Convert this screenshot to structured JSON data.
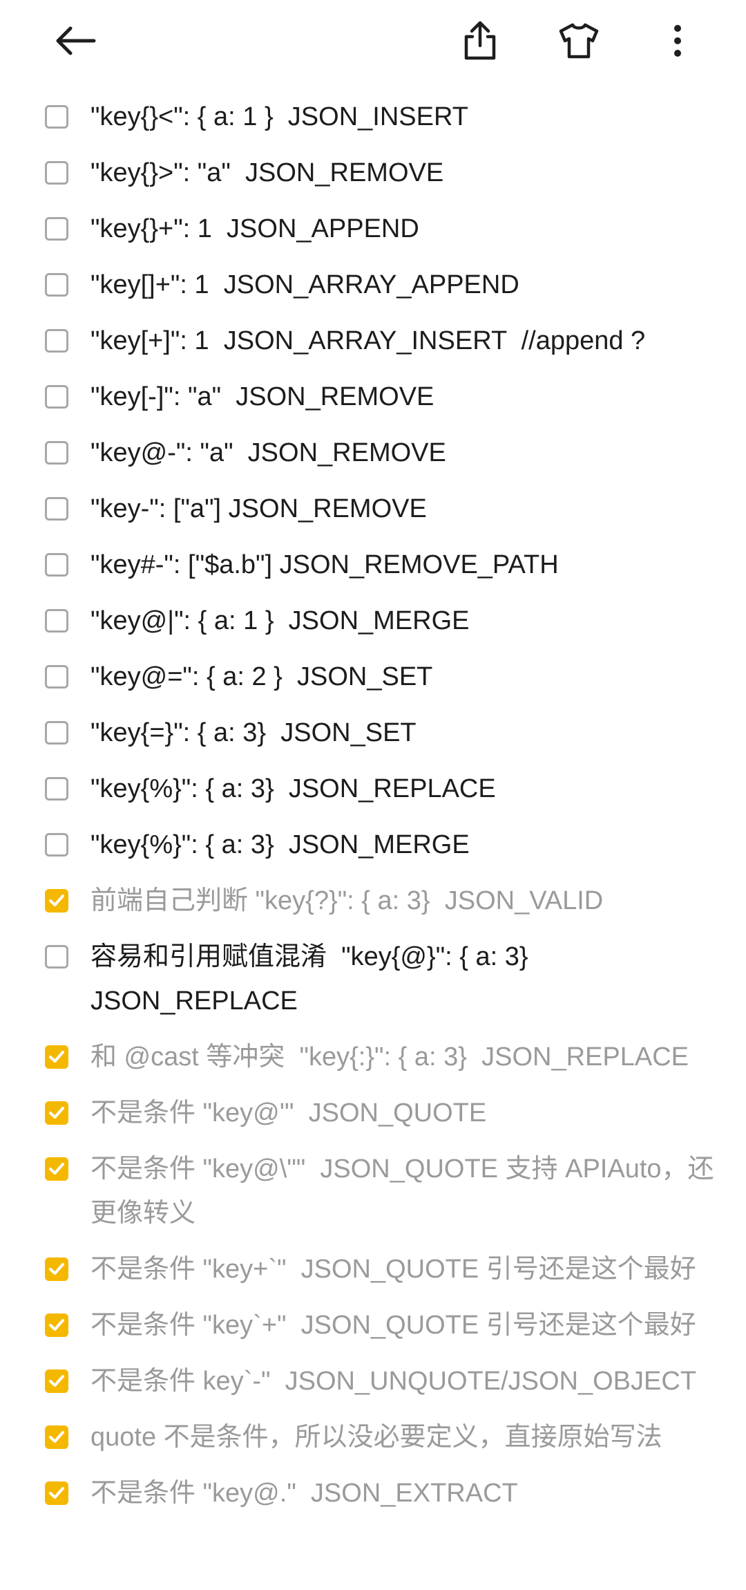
{
  "toolbar": {
    "back_icon": "arrow-left-icon",
    "share_icon": "share-icon",
    "theme_icon": "tshirt-icon",
    "more_icon": "more-vertical-icon"
  },
  "colors": {
    "checked_accent": "#f5b800",
    "checked_text": "#9a9a9a",
    "unchecked_text": "#1c1c1c"
  },
  "items": [
    {
      "checked": false,
      "text": "\"key{}<\": { a: 1 }  JSON_INSERT"
    },
    {
      "checked": false,
      "text": "\"key{}>\": \"a\"  JSON_REMOVE"
    },
    {
      "checked": false,
      "text": "\"key{}+\": 1  JSON_APPEND"
    },
    {
      "checked": false,
      "text": "\"key[]+\": 1  JSON_ARRAY_APPEND"
    },
    {
      "checked": false,
      "text": "\"key[+]\": 1  JSON_ARRAY_INSERT  //append ?"
    },
    {
      "checked": false,
      "text": "\"key[-]\": \"a\"  JSON_REMOVE"
    },
    {
      "checked": false,
      "text": "\"key@-\": \"a\"  JSON_REMOVE"
    },
    {
      "checked": false,
      "text": "\"key-\": [\"a\"] JSON_REMOVE"
    },
    {
      "checked": false,
      "text": "\"key#-\": [\"$a.b\"] JSON_REMOVE_PATH"
    },
    {
      "checked": false,
      "text": "\"key@|\": { a: 1 }  JSON_MERGE"
    },
    {
      "checked": false,
      "text": "\"key@=\": { a: 2 }  JSON_SET"
    },
    {
      "checked": false,
      "text": "\"key{=}\": { a: 3}  JSON_SET"
    },
    {
      "checked": false,
      "text": "\"key{%}\": { a: 3}  JSON_REPLACE"
    },
    {
      "checked": false,
      "text": "\"key{%}\": { a: 3}  JSON_MERGE"
    },
    {
      "checked": true,
      "text": "前端自己判断 \"key{?}\": { a: 3}  JSON_VALID"
    },
    {
      "checked": false,
      "text": "容易和引用赋值混淆  \"key{@}\": { a: 3} JSON_REPLACE"
    },
    {
      "checked": true,
      "text": "和 @cast 等冲突  \"key{:}\": { a: 3}  JSON_REPLACE"
    },
    {
      "checked": true,
      "text": "不是条件 \"key@'\"  JSON_QUOTE"
    },
    {
      "checked": true,
      "text": "不是条件 \"key@\\\"\"  JSON_QUOTE 支持 APIAuto，还更像转义"
    },
    {
      "checked": true,
      "text": "不是条件 \"key+`\"  JSON_QUOTE 引号还是这个最好"
    },
    {
      "checked": true,
      "text": "不是条件 \"key`+\"  JSON_QUOTE 引号还是这个最好"
    },
    {
      "checked": true,
      "text": "不是条件 key`-\"  JSON_UNQUOTE/JSON_OBJECT"
    },
    {
      "checked": true,
      "text": "quote 不是条件，所以没必要定义，直接原始写法"
    },
    {
      "checked": true,
      "text": "不是条件 \"key@.\"  JSON_EXTRACT"
    }
  ]
}
